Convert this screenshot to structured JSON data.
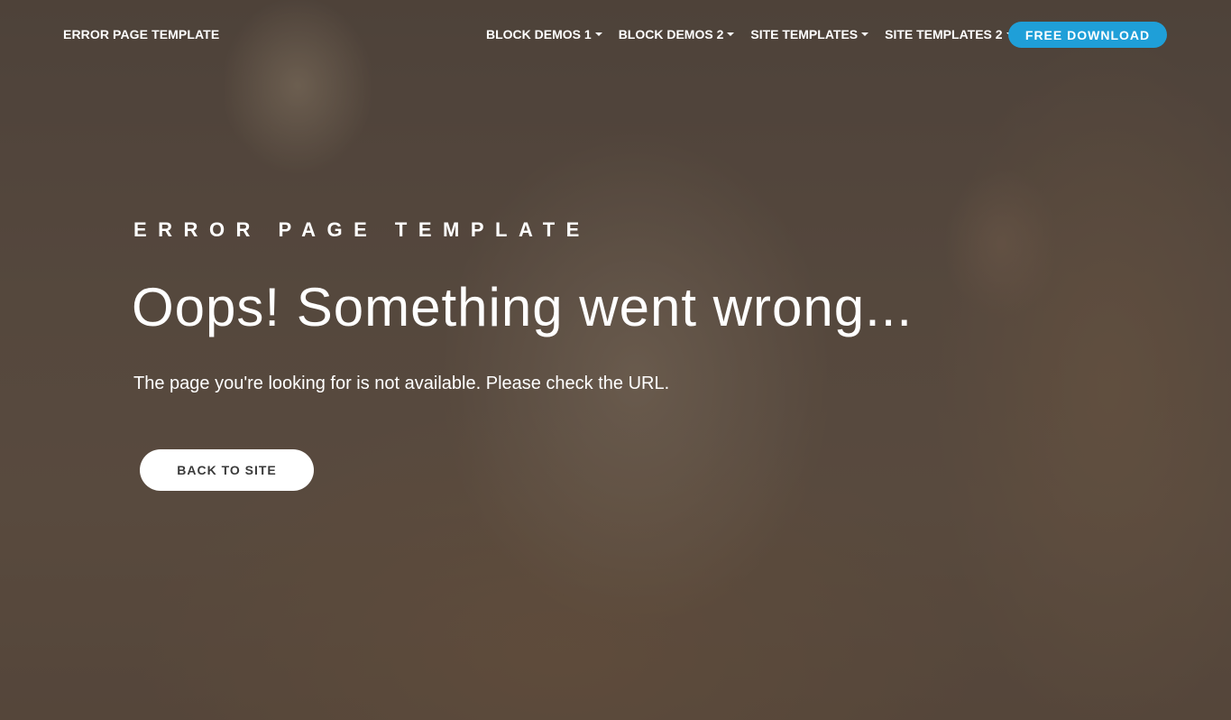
{
  "navbar": {
    "brand": "ERROR PAGE TEMPLATE",
    "items": [
      {
        "label": "BLOCK DEMOS 1",
        "icon": "caret-down-icon"
      },
      {
        "label": "BLOCK DEMOS 2",
        "icon": "caret-down-icon"
      },
      {
        "label": "SITE TEMPLATES",
        "icon": "caret-down-icon"
      },
      {
        "label": "SITE TEMPLATES 2",
        "icon": "caret-down-icon"
      }
    ],
    "cta_label": "FREE DOWNLOAD"
  },
  "hero": {
    "eyebrow": "ERROR PAGE TEMPLATE",
    "headline": "Oops! Something went wrong...",
    "subtext": "The page you're looking for is not available. Please check the URL.",
    "button_label": "BACK TO SITE",
    "background": "blurred photo of a tabby cat looking up"
  },
  "colors": {
    "accent": "#1f9fd8",
    "text": "#ffffff",
    "button_bg": "#ffffff",
    "button_text": "#3a3a3a"
  }
}
